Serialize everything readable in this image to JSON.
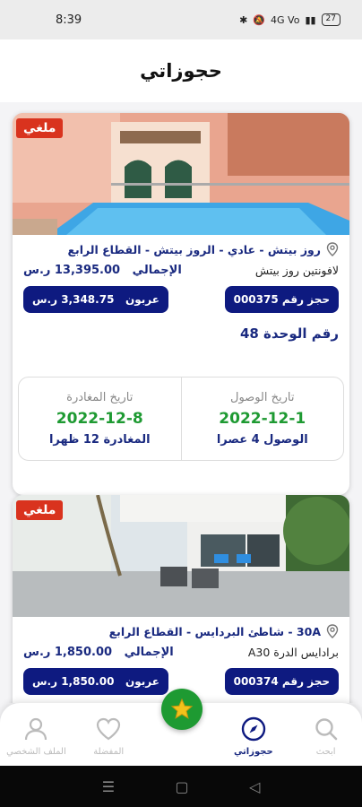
{
  "status_bar": {
    "time": "8:39",
    "network": "4G Vo",
    "battery": "27"
  },
  "header": {
    "title": "حجوزاتي"
  },
  "bookings": [
    {
      "status_badge": "ملغي",
      "location": "روز بيتش - عادي - الروز بيتش - القطاع الرابع",
      "sub_name": "لافونتين روز بيتش",
      "total_label": "الإجمالي",
      "total_value": "13,395.00 ر.س",
      "booking_no": "حجز رقم 000375",
      "deposit_label": "عربون",
      "deposit_value": "3,348.75 ر.س",
      "unit_no": "رقم الوحدة 48",
      "arrival_label": "تاريخ الوصول",
      "arrival_date": "2022-12-1",
      "arrival_time": "الوصول 4 عصرا",
      "departure_label": "تاريخ المغادرة",
      "departure_date": "2022-12-8",
      "departure_time": "المغادرة 12 ظهرا"
    },
    {
      "status_badge": "ملغي",
      "location": "30A - شاطئ البردايس - القطاع الرابع",
      "sub_name": "برادايس الدرة A30",
      "total_label": "الإجمالي",
      "total_value": "1,850.00 ر.س",
      "booking_no": "حجز رقم 000374",
      "deposit_label": "عربون",
      "deposit_value": "1,850.00 ر.س"
    }
  ],
  "nav": {
    "search": "ابحث",
    "bookings": "حجوزاتي",
    "favorites": "المفضلة",
    "profile": "الملف الشخصي"
  },
  "colors": {
    "primary": "#0e1a80",
    "accent_green": "#1e9a32",
    "cancel_red": "#d9331e"
  }
}
